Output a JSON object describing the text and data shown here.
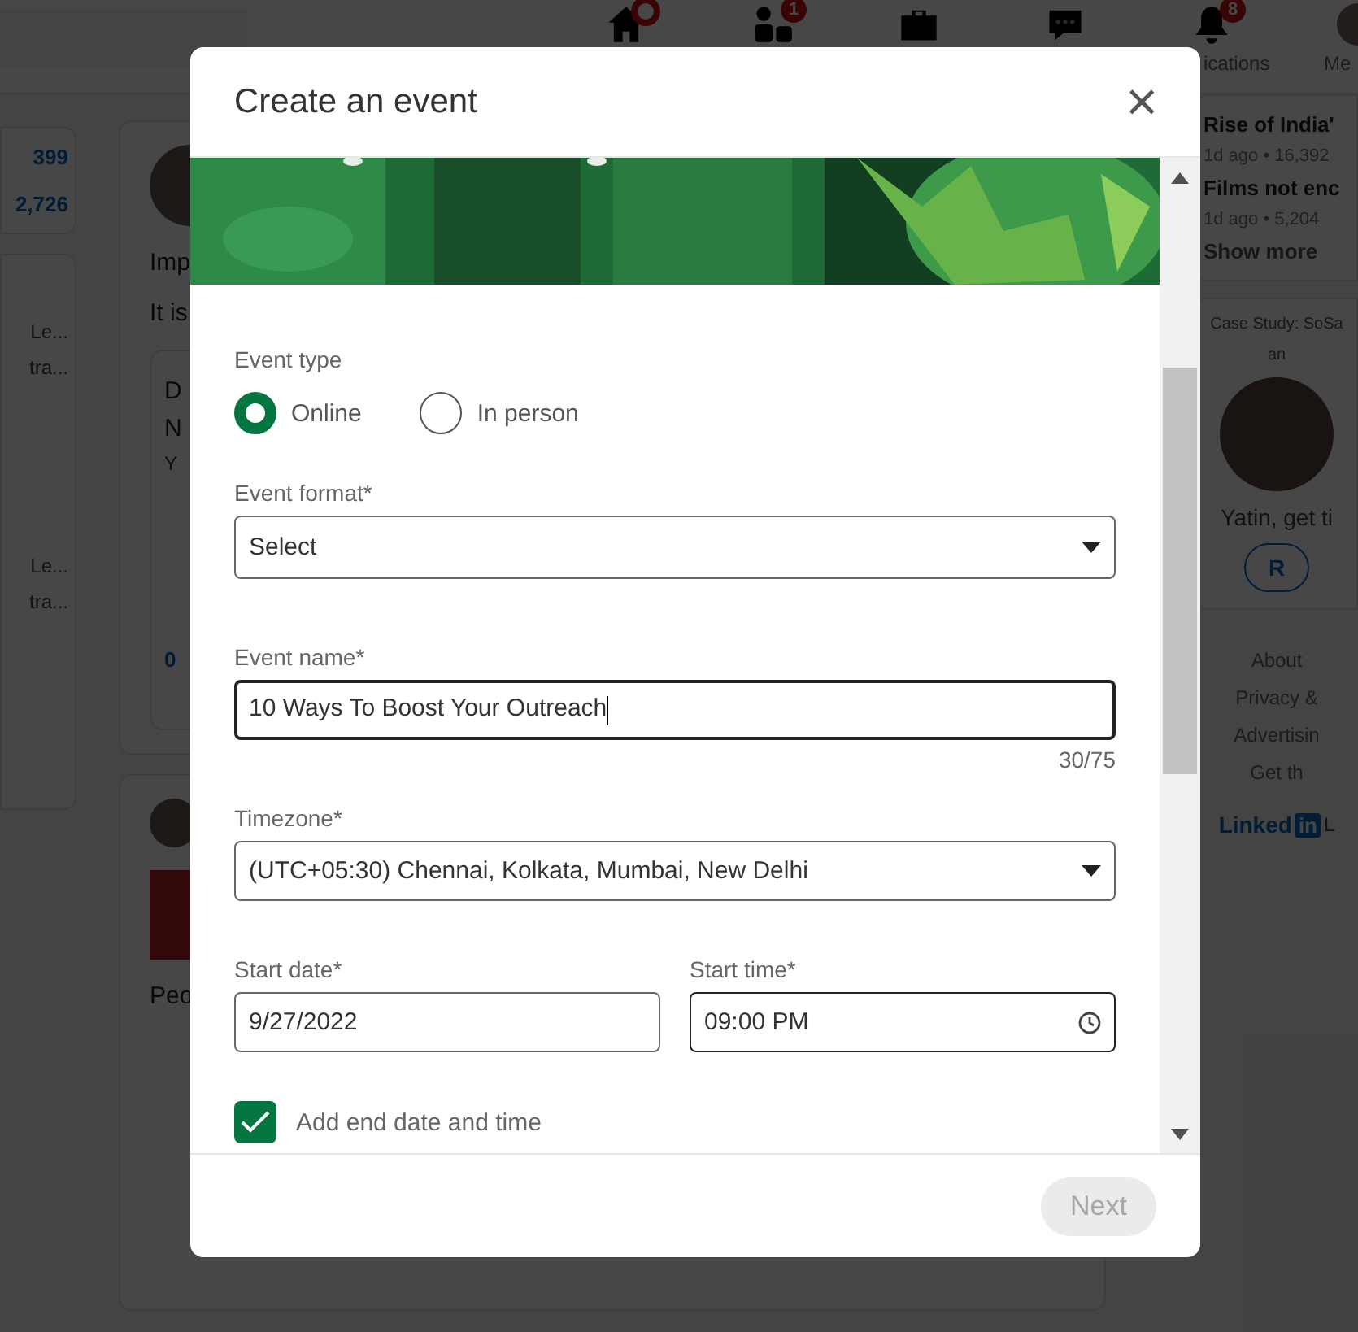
{
  "nav": {
    "items": [
      {
        "kind": "home",
        "dot": true
      },
      {
        "kind": "people",
        "badge": "1"
      },
      {
        "kind": "briefcase"
      },
      {
        "kind": "chat"
      },
      {
        "kind": "bell",
        "badge": "8",
        "label": "ications"
      },
      {
        "kind": "avatar",
        "label": "Me"
      }
    ]
  },
  "left_panel": {
    "stats": [
      "399",
      "2,726"
    ],
    "items": [
      {
        "line_1": "Le...",
        "line_2": "tra..."
      },
      {
        "line_1": "Le...",
        "line_2": "tra..."
      }
    ]
  },
  "feed": {
    "post_1": {
      "text_1": "Imp",
      "text_2": "It is",
      "card_title_1": "D",
      "card_title_2": "N",
      "card_sub": "Y",
      "card_link": "0"
    },
    "post_2": {
      "text": "Peo"
    }
  },
  "right_panel": {
    "news": [
      {
        "title": "Rise of India'",
        "meta": "1d ago • 16,392"
      },
      {
        "title": "Films not enc",
        "meta": "1d ago • 5,204"
      }
    ],
    "show_more": "Show more",
    "ad": {
      "caption_1": "Case Study: SoSa",
      "caption_2": "an",
      "text": "Yatin, get ti",
      "button": "R"
    },
    "footer_links": [
      "About",
      "Privacy &",
      "Advertisin",
      "Get th"
    ],
    "brand": {
      "word": "Linked",
      "box": "in",
      "after": "L"
    }
  },
  "modal": {
    "title": "Create an event",
    "close": "×",
    "event_type": {
      "label": "Event type",
      "options": [
        {
          "label": "Online",
          "selected": true
        },
        {
          "label": "In person",
          "selected": false
        }
      ]
    },
    "event_format": {
      "label": "Event format*",
      "value": "Select"
    },
    "event_name": {
      "label": "Event name*",
      "value": "10 Ways To Boost Your Outreach",
      "focused": true,
      "counter": "30/75"
    },
    "timezone": {
      "label": "Timezone*",
      "value": "(UTC+05:30) Chennai, Kolkata, Mumbai, New Delhi"
    },
    "start_date": {
      "label": "Start date*",
      "value": "9/27/2022"
    },
    "start_time": {
      "label": "Start time*",
      "value": "09:00 PM"
    },
    "end_toggle": {
      "label": "Add end date and time",
      "checked": true
    },
    "next": {
      "label": "Next",
      "disabled": true
    }
  }
}
